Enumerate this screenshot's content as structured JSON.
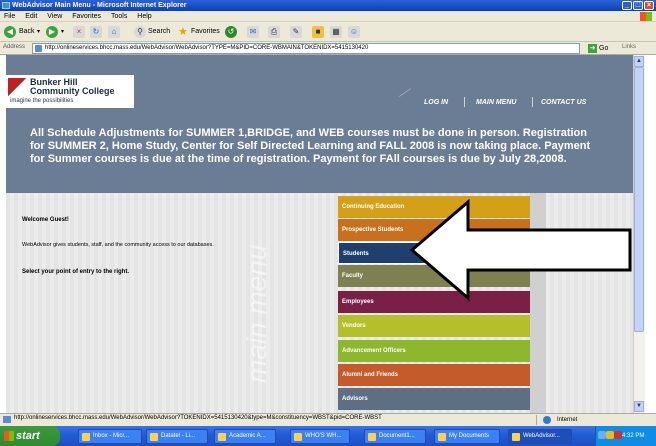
{
  "window": {
    "title": "WebAdvisor Main Menu - Microsoft Internet Explorer",
    "minimize": "_",
    "maximize": "□",
    "close": "×"
  },
  "menubar": [
    "File",
    "Edit",
    "View",
    "Favorites",
    "Tools",
    "Help"
  ],
  "toolbar": {
    "back_label": "Back",
    "search_label": "Search",
    "favorites_label": "Favorites"
  },
  "address": {
    "label": "Address",
    "url": "http://onlineservices.bhcc.mass.edu/WebAdvisor/WebAdvisor?TYPE=M&PID=CORE-WBMAIN&TOKENIDX=5415130420",
    "go_label": "Go",
    "links_label": "Links"
  },
  "header": {
    "college_name_line1": "Bunker Hill",
    "college_name_line2": "Community College",
    "tagline": "imagine the possibilities",
    "nav": [
      "LOG IN",
      "MAIN MENU",
      "CONTACT US"
    ]
  },
  "announcement": "All Schedule Adjustments for SUMMER 1,BRIDGE, and WEB courses must be done in person. Registration for SUMMER 2, Home Study, Center for Self Directed Learning and FALL 2008 is now taking place. Payment for Summer courses is due at the time of registration. Payment for FAll courses is due by July 28,2008.",
  "welcome": {
    "title": "Welcome Guest!",
    "description": "WebAdvisor gives students, staff, and the community access to our databases.",
    "instruction": "Select your point of entry to the right."
  },
  "main_menu_watermark": "main menu",
  "menu_items": [
    {
      "label": "Continuing Education",
      "color": "#d4a017"
    },
    {
      "label": "Prospective Students",
      "color": "#c8701e"
    },
    {
      "label": "Students",
      "color": "#1f3f6e"
    },
    {
      "label": "Faculty",
      "color": "#7e8050"
    },
    {
      "label": "Employees",
      "color": "#7a1f45"
    },
    {
      "label": "Vendors",
      "color": "#b5bf2c"
    },
    {
      "label": "Advancement Officers",
      "color": "#8db82e"
    },
    {
      "label": "Alumni and Friends",
      "color": "#c55a2a"
    },
    {
      "label": "Advisors",
      "color": "#5e6f84"
    }
  ],
  "status": {
    "url": "http://onlineservices.bhcc.mass.edu/WebAdvisor/WebAdvisor?TOKENIDX=5415130420&type=M&constituency=WBST&pid=CORE-WBST",
    "zone": "Internet"
  },
  "taskbar": {
    "start_label": "start",
    "tasks": [
      "Inbox - Micr...",
      "Datatel - Li...",
      "Academic A...",
      "WHO'S WH...",
      "Document1...",
      "My Documents",
      "WebAdvisor..."
    ],
    "clock": "4:32 PM"
  }
}
